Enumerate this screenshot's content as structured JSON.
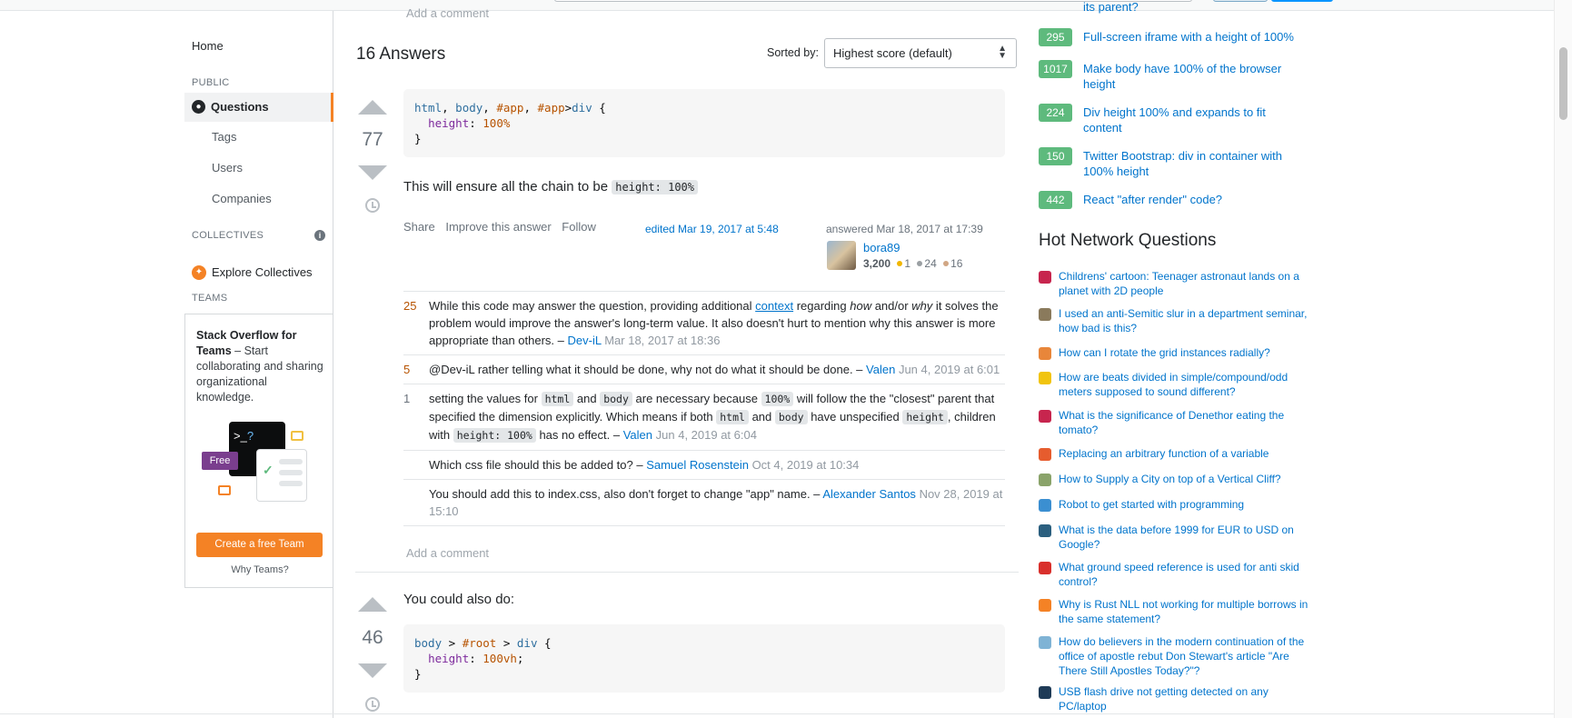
{
  "top": {
    "add_comment": "Add a comment"
  },
  "leftnav": {
    "home": "Home",
    "public_heading": "PUBLIC",
    "questions": "Questions",
    "tags": "Tags",
    "users": "Users",
    "companies": "Companies",
    "collectives_heading": "COLLECTIVES",
    "explore_collectives": "Explore Collectives",
    "teams_heading": "TEAMS",
    "teams_title": "Stack Overflow for Teams",
    "teams_desc": " – Start collaborating and sharing organizational knowledge.",
    "free_label": "Free",
    "create_team": "Create a free Team",
    "why_teams": "Why Teams?"
  },
  "answers": {
    "count_heading": "16 Answers",
    "sorted_by": "Sorted by:",
    "sort_value": "Highest score (default)",
    "add_comment": "Add a comment"
  },
  "answer1": {
    "votes": "77",
    "text_prefix": "This will ensure all the chain to be ",
    "text_code": "height: 100%",
    "menu": {
      "share": "Share",
      "improve": "Improve this answer",
      "follow": "Follow"
    },
    "edited": "edited Mar 19, 2017 at 5:48",
    "answered": "answered Mar 18, 2017 at 17:39",
    "user": {
      "name": "bora89",
      "rep": "3,200",
      "gold": "1",
      "silver": "24",
      "bronze": "16"
    },
    "comments": [
      {
        "score": "25",
        "parts": {
          "a": "While this code may answer the question, providing additional ",
          "link": "context",
          "b": " regarding ",
          "i1": "how",
          "c": " and/or ",
          "i2": "why",
          "d": " it solves the problem would improve the answer's long-term value. It also doesn't hurt to mention why this answer is more appropriate than others. – "
        },
        "author": "Dev-iL",
        "date": "Mar 18, 2017 at 18:36"
      },
      {
        "score": "5",
        "text": "@Dev-iL rather telling what it should be done, why not do what it should be done. – ",
        "author": "Valen",
        "date": "Jun 4, 2019 at 6:01"
      },
      {
        "score": "1",
        "parts": {
          "a": "setting the values for ",
          "c1": "html",
          "b": " and ",
          "c2": "body",
          "c": " are necessary because ",
          "c3": "100%",
          "d": " will follow the the \"closest\" parent that specified the dimension explicitly. Which means if both ",
          "c4": "html",
          "e": " and ",
          "c5": "body",
          "f": " have unspecified ",
          "c6": "height",
          "g": ", children with ",
          "c7": "height: 100%",
          "h": " has no effect. – "
        },
        "author": "Valen",
        "date": "Jun 4, 2019 at 6:04"
      },
      {
        "score": "",
        "text": "Which css file should this be added to? – ",
        "author": "Samuel Rosenstein",
        "date": "Oct 4, 2019 at 10:34"
      },
      {
        "score": "",
        "text": "You should add this to index.css, also don't forget to change \"app\" name. – ",
        "author": "Alexander Santos",
        "date": "Nov 28, 2019 at 15:10"
      }
    ]
  },
  "answer2": {
    "votes": "46",
    "text": "You could also do:"
  },
  "related": [
    {
      "score": "295",
      "title": "Full-screen iframe with a height of 100%"
    },
    {
      "score": "1017",
      "title": "Make body have 100% of the browser height"
    },
    {
      "score": "224",
      "title": "Div height 100% and expands to fit content"
    },
    {
      "score": "150",
      "title": "Twitter Bootstrap: div in container with 100% height"
    },
    {
      "score": "442",
      "title": "React \"after render\" code?"
    }
  ],
  "related_partial": "its parent?",
  "hnq": {
    "heading": "Hot Network Questions",
    "items": [
      {
        "title": "Childrens' cartoon: Teenager astronaut lands on a planet with 2D people",
        "color": "#c7254e"
      },
      {
        "title": "I used an anti-Semitic slur in a department seminar, how bad is this?",
        "color": "#8a7a5c"
      },
      {
        "title": "How can I rotate the grid instances radially?",
        "color": "#e8863a"
      },
      {
        "title": "How are beats divided in simple/compound/odd meters supposed to sound different?",
        "color": "#f1c40f"
      },
      {
        "title": "What is the significance of Denethor eating the tomato?",
        "color": "#c7254e"
      },
      {
        "title": "Replacing an arbitrary function of a variable",
        "color": "#e65c2e"
      },
      {
        "title": "How to Supply a City on top of a Vertical Cliff?",
        "color": "#8aa36a"
      },
      {
        "title": "Robot to get started with programming",
        "color": "#3b8fd1"
      },
      {
        "title": "What is the data before 1999 for EUR to USD on Google?",
        "color": "#2b5f7f"
      },
      {
        "title": "What ground speed reference is used for anti skid control?",
        "color": "#d9302c"
      },
      {
        "title": "Why is Rust NLL not working for multiple borrows in the same statement?",
        "color": "#f48225"
      },
      {
        "title": "How do believers in the modern continuation of the office of apostle rebut Don Stewart's article \"Are There Still Apostles Today?\"?",
        "color": "#7fb3d5"
      },
      {
        "title": "USB flash drive not getting detected on any PC/laptop",
        "color": "#1f3b57"
      }
    ]
  }
}
